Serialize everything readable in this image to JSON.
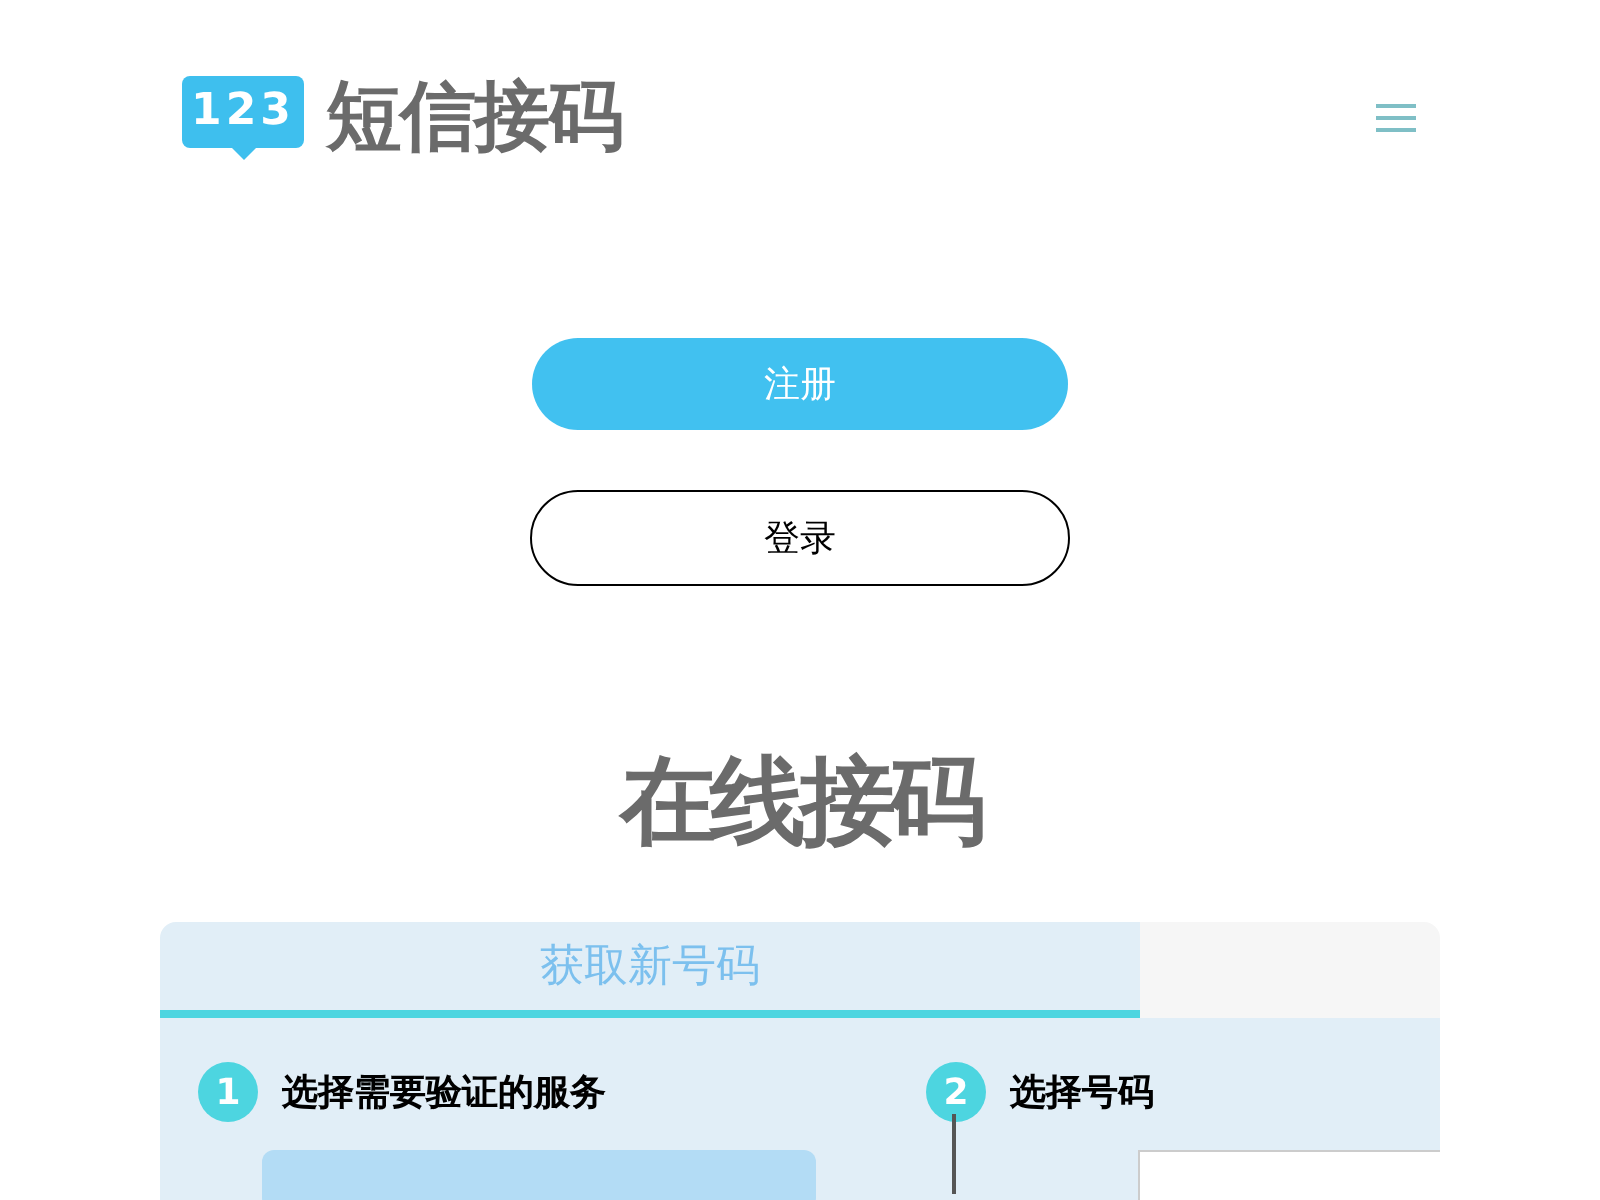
{
  "header": {
    "logo_badge": "123",
    "logo_text": "短信接码"
  },
  "auth_buttons": [
    {
      "label": "注册",
      "kind": "primary"
    },
    {
      "label": "登录",
      "kind": "outline"
    }
  ],
  "heading": "在线接码",
  "tabs": [
    {
      "label": "获取新号码",
      "selected": true
    }
  ],
  "steps": [
    {
      "number": "1",
      "title": "选择需要验证的服务"
    },
    {
      "number": "2",
      "title": "选择号码"
    }
  ]
}
